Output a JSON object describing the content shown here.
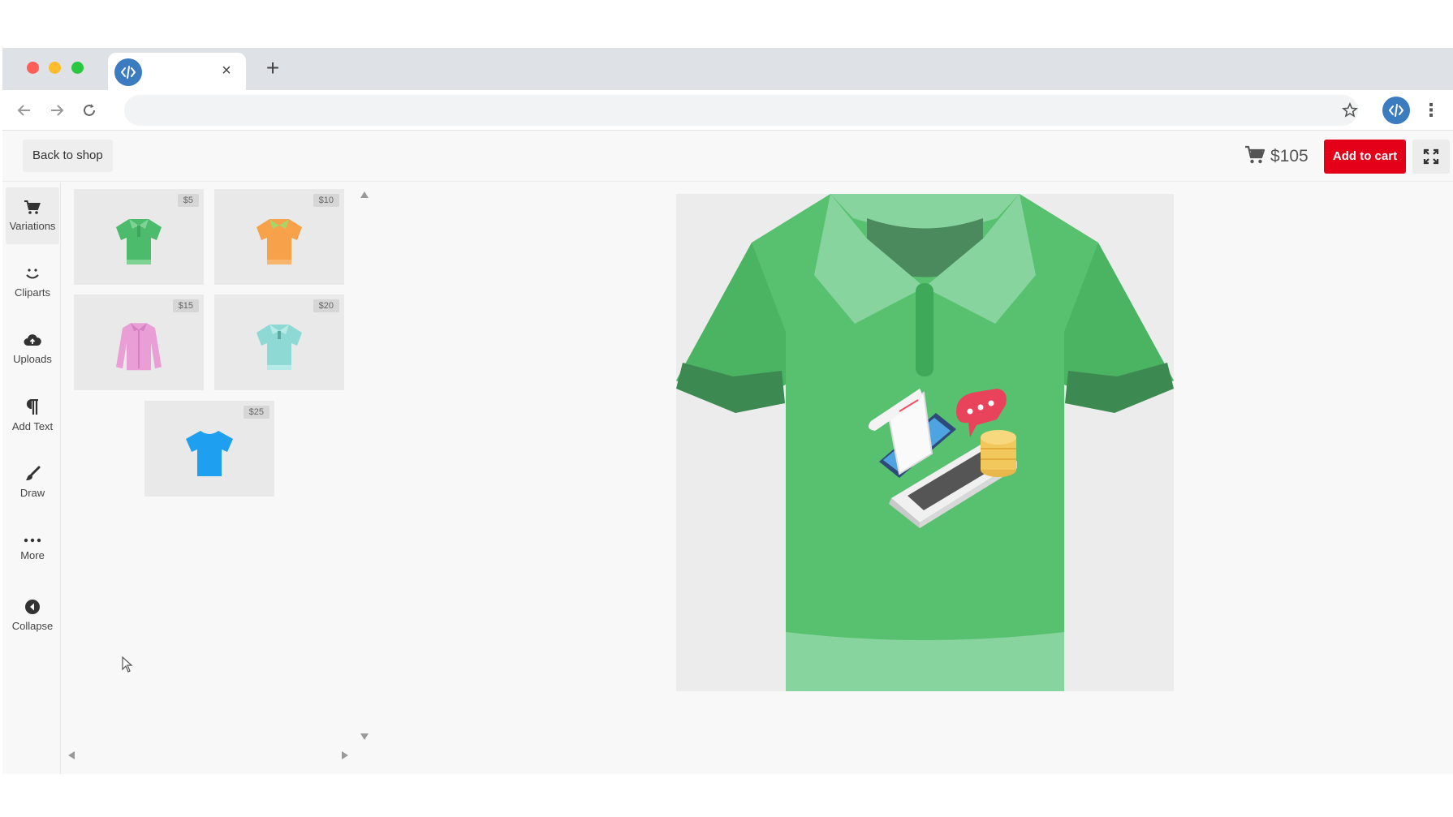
{
  "browser": {
    "tab_close": "×",
    "new_tab": "+",
    "menu": "⋮"
  },
  "header": {
    "back_label": "Back to shop",
    "price": "$105",
    "add_to_cart_label": "Add to cart"
  },
  "sidebar": {
    "items": [
      {
        "label": "Variations",
        "icon": "cart-icon"
      },
      {
        "label": "Cliparts",
        "icon": "smile-icon"
      },
      {
        "label": "Uploads",
        "icon": "cloud-upload-icon"
      },
      {
        "label": "Add Text",
        "icon": "paragraph-icon"
      },
      {
        "label": "Draw",
        "icon": "brush-icon"
      },
      {
        "label": "More",
        "icon": "dots-icon"
      },
      {
        "label": "Collapse",
        "icon": "collapse-icon"
      }
    ]
  },
  "variations": [
    {
      "price": "$5",
      "color": "#4cbb6c",
      "style": "polo"
    },
    {
      "price": "$10",
      "color": "#f7a24b",
      "style": "polo"
    },
    {
      "price": "$15",
      "color": "#e99fd6",
      "style": "longsleeve"
    },
    {
      "price": "$20",
      "color": "#8fd9d4",
      "style": "polo"
    },
    {
      "price": "$25",
      "color": "#1e9ff0",
      "style": "tee"
    }
  ],
  "colors": {
    "accent_red": "#e5001a",
    "shirt_green": "#57c16f",
    "brand_blue": "#3b7bbf"
  }
}
